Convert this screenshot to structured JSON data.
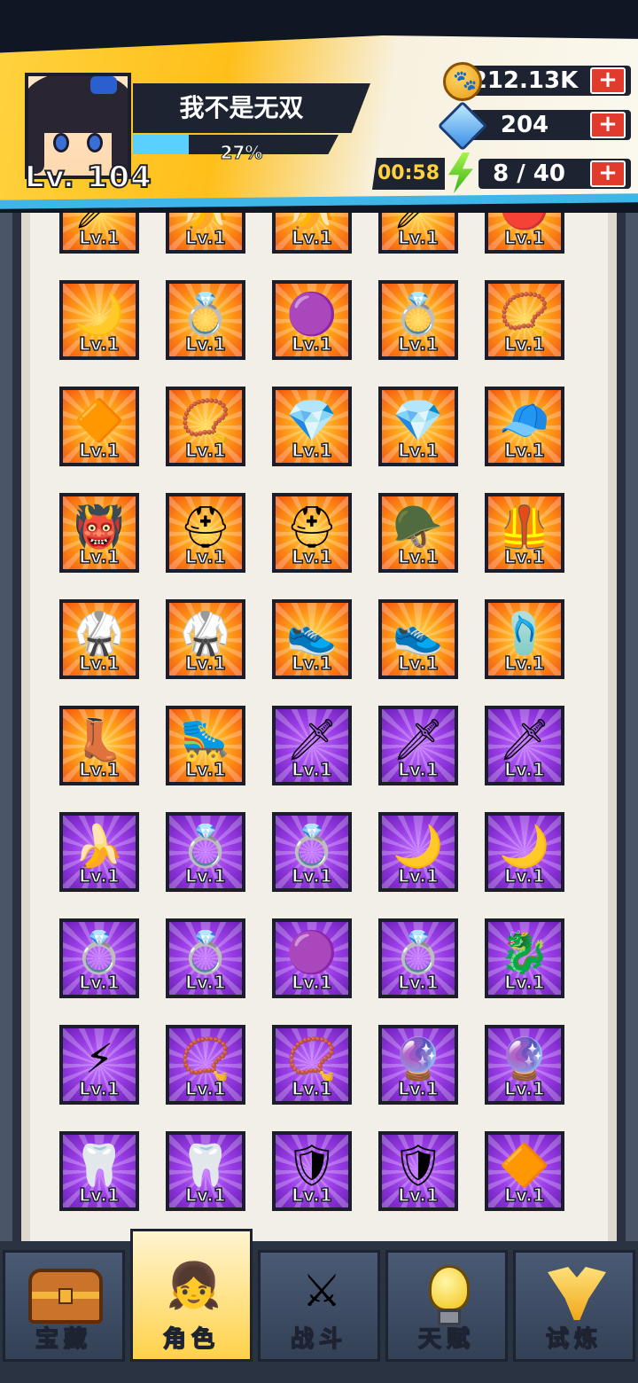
{
  "player": {
    "name": "我不是无双",
    "level_text": "Lv. 104",
    "exp_percent_text": "27%",
    "exp_fraction": 0.27
  },
  "resources": {
    "coins": "212.13K",
    "gems": "204",
    "energy_timer": "00:58",
    "energy": "8 / 40",
    "plus_symbol": "+"
  },
  "colors": {
    "orange_rarity": "#f57a12",
    "purple_rarity": "#9a3de6",
    "accent_yellow": "#ffd23e",
    "plus_red": "#e03b2d"
  },
  "items": [
    {
      "icon": "blue-blade",
      "glyph": "🗡",
      "rarity": "orange",
      "level": "Lv.1"
    },
    {
      "icon": "yellow-blade",
      "glyph": "🍌",
      "rarity": "orange",
      "level": "Lv.1"
    },
    {
      "icon": "yellow-blade",
      "glyph": "🍌",
      "rarity": "orange",
      "level": "Lv.1"
    },
    {
      "icon": "silver-blade",
      "glyph": "🗡",
      "rarity": "orange",
      "level": "Lv.1"
    },
    {
      "icon": "red-charm",
      "glyph": "🔴",
      "rarity": "orange",
      "level": "Lv.1"
    },
    {
      "icon": "crescent-ring",
      "glyph": "🌙",
      "rarity": "orange",
      "level": "Lv.1"
    },
    {
      "icon": "gold-ring",
      "glyph": "💍",
      "rarity": "orange",
      "level": "Lv.1"
    },
    {
      "icon": "purple-ring",
      "glyph": "🟣",
      "rarity": "orange",
      "level": "Lv.1"
    },
    {
      "icon": "ruby-ring",
      "glyph": "💍",
      "rarity": "orange",
      "level": "Lv.1"
    },
    {
      "icon": "bead-necklace",
      "glyph": "📿",
      "rarity": "orange",
      "level": "Lv.1"
    },
    {
      "icon": "gold-pendant",
      "glyph": "🔶",
      "rarity": "orange",
      "level": "Lv.1"
    },
    {
      "icon": "red-bead-necklace",
      "glyph": "📿",
      "rarity": "orange",
      "level": "Lv.1"
    },
    {
      "icon": "crystal-pendant",
      "glyph": "💎",
      "rarity": "orange",
      "level": "Lv.1"
    },
    {
      "icon": "crystal-pendant",
      "glyph": "💎",
      "rarity": "orange",
      "level": "Lv.1"
    },
    {
      "icon": "white-cap",
      "glyph": "🧢",
      "rarity": "orange",
      "level": "Lv.1"
    },
    {
      "icon": "dragon-mask",
      "glyph": "👹",
      "rarity": "orange",
      "level": "Lv.1"
    },
    {
      "icon": "tactical-helmet",
      "glyph": "⛑",
      "rarity": "orange",
      "level": "Lv.1"
    },
    {
      "icon": "tactical-helmet",
      "glyph": "⛑",
      "rarity": "orange",
      "level": "Lv.1"
    },
    {
      "icon": "pink-helmet",
      "glyph": "🪖",
      "rarity": "orange",
      "level": "Lv.1"
    },
    {
      "icon": "tactical-vest",
      "glyph": "🦺",
      "rarity": "orange",
      "level": "Lv.1"
    },
    {
      "icon": "karate-gi",
      "glyph": "🥋",
      "rarity": "orange",
      "level": "Lv.1"
    },
    {
      "icon": "karate-gi",
      "glyph": "🥋",
      "rarity": "orange",
      "level": "Lv.1"
    },
    {
      "icon": "pink-sneaker",
      "glyph": "👟",
      "rarity": "orange",
      "level": "Lv.1"
    },
    {
      "icon": "pink-sneaker",
      "glyph": "👟",
      "rarity": "orange",
      "level": "Lv.1"
    },
    {
      "icon": "blue-slipper",
      "glyph": "🩴",
      "rarity": "orange",
      "level": "Lv.1"
    },
    {
      "icon": "blue-boot",
      "glyph": "👢",
      "rarity": "orange",
      "level": "Lv.1"
    },
    {
      "icon": "roller-skate",
      "glyph": "🛼",
      "rarity": "orange",
      "level": "Lv.1"
    },
    {
      "icon": "red-blade",
      "glyph": "🗡",
      "rarity": "purple",
      "level": "Lv.1"
    },
    {
      "icon": "red-blade",
      "glyph": "🗡",
      "rarity": "purple",
      "level": "Lv.1"
    },
    {
      "icon": "blue-blade",
      "glyph": "🗡",
      "rarity": "purple",
      "level": "Lv.1"
    },
    {
      "icon": "yellow-blade",
      "glyph": "🍌",
      "rarity": "purple",
      "level": "Lv.1"
    },
    {
      "icon": "bronze-seal-ring",
      "glyph": "💍",
      "rarity": "purple",
      "level": "Lv.1"
    },
    {
      "icon": "bronze-seal-ring",
      "glyph": "💍",
      "rarity": "purple",
      "level": "Lv.1"
    },
    {
      "icon": "crescent-ring",
      "glyph": "🌙",
      "rarity": "purple",
      "level": "Lv.1"
    },
    {
      "icon": "crescent-ring",
      "glyph": "🌙",
      "rarity": "purple",
      "level": "Lv.1"
    },
    {
      "icon": "gold-ring",
      "glyph": "💍",
      "rarity": "purple",
      "level": "Lv.1"
    },
    {
      "icon": "gold-ring",
      "glyph": "💍",
      "rarity": "purple",
      "level": "Lv.1"
    },
    {
      "icon": "purple-ring",
      "glyph": "🟣",
      "rarity": "purple",
      "level": "Lv.1"
    },
    {
      "icon": "ruby-ring",
      "glyph": "💍",
      "rarity": "purple",
      "level": "Lv.1"
    },
    {
      "icon": "dragon-ring",
      "glyph": "🐉",
      "rarity": "purple",
      "level": "Lv.1"
    },
    {
      "icon": "lightning-pendant",
      "glyph": "⚡",
      "rarity": "purple",
      "level": "Lv.1"
    },
    {
      "icon": "bead-necklace",
      "glyph": "📿",
      "rarity": "purple",
      "level": "Lv.1"
    },
    {
      "icon": "bead-necklace",
      "glyph": "📿",
      "rarity": "purple",
      "level": "Lv.1"
    },
    {
      "icon": "purple-orb-pendant",
      "glyph": "🔮",
      "rarity": "purple",
      "level": "Lv.1"
    },
    {
      "icon": "purple-orb-pendant",
      "glyph": "🔮",
      "rarity": "purple",
      "level": "Lv.1"
    },
    {
      "icon": "fang-necklace",
      "glyph": "🦷",
      "rarity": "purple",
      "level": "Lv.1"
    },
    {
      "icon": "fang-necklace",
      "glyph": "🦷",
      "rarity": "purple",
      "level": "Lv.1"
    },
    {
      "icon": "hex-badge",
      "glyph": "🛡",
      "rarity": "purple",
      "level": "Lv.1"
    },
    {
      "icon": "hex-badge",
      "glyph": "🛡",
      "rarity": "purple",
      "level": "Lv.1"
    },
    {
      "icon": "gold-pendant",
      "glyph": "🔶",
      "rarity": "purple",
      "level": "Lv.1"
    }
  ],
  "nav": {
    "tabs": [
      {
        "id": "treasure",
        "label": "宝藏",
        "icon": "treasure-chest-icon",
        "active": false
      },
      {
        "id": "character",
        "label": "角色",
        "icon": "character-portrait-icon",
        "active": true
      },
      {
        "id": "battle",
        "label": "战斗",
        "icon": "crossed-swords-icon",
        "active": false
      },
      {
        "id": "talent",
        "label": "天赋",
        "icon": "lightbulb-icon",
        "active": false
      },
      {
        "id": "trial",
        "label": "试炼",
        "icon": "trophy-icon",
        "active": false
      }
    ]
  }
}
